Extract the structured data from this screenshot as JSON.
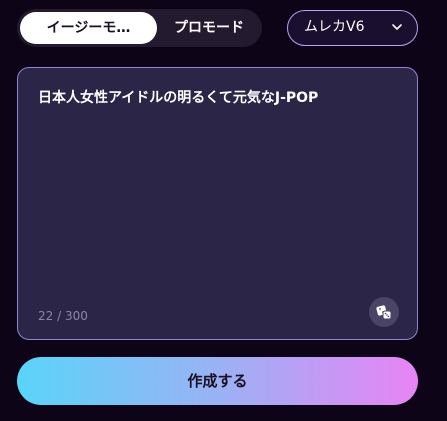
{
  "mode_toggle": {
    "easy_label": "イージーモ…",
    "pro_label": "プロモード"
  },
  "model_select": {
    "value": "ムレカV6",
    "icon": "chevron-down-icon"
  },
  "prompt": {
    "text": "日本人女性アイドルの明るくて元気なJ-POP",
    "counter": "22 / 300",
    "random_icon": "dice-icon"
  },
  "create_button": {
    "label": "作成する"
  },
  "colors": {
    "background": "#0e0418",
    "toggle_bg": "#231a30",
    "prompt_bg": "#2b2548",
    "prompt_border": "#8f86d6",
    "select_border": "#b3a4f0",
    "gradient_start": "#5ad4f8",
    "gradient_end": "#e884f5"
  }
}
